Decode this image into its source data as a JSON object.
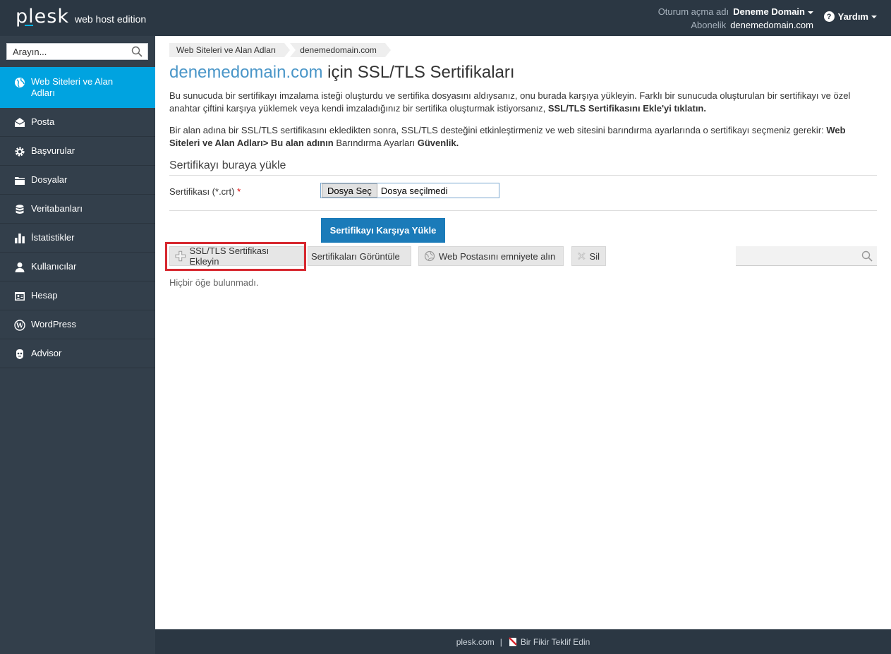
{
  "header": {
    "logo": "plesk",
    "edition": "web host edition",
    "login_label": "Oturum açma adı",
    "login_value": "Deneme Domain",
    "subscription_label": "Abonelik",
    "subscription_value": "denemedomain.com",
    "help_label": "Yardım"
  },
  "sidebar": {
    "search_placeholder": "Arayın...",
    "items": [
      {
        "label": "Web Siteleri ve Alan Adları",
        "icon": "globe-icon",
        "active": true
      },
      {
        "label": "Posta",
        "icon": "mail-icon"
      },
      {
        "label": "Başvurular",
        "icon": "gear-icon"
      },
      {
        "label": "Dosyalar",
        "icon": "folder-icon"
      },
      {
        "label": "Veritabanları",
        "icon": "database-icon"
      },
      {
        "label": "İstatistikler",
        "icon": "bar-chart-icon"
      },
      {
        "label": "Kullanıcılar",
        "icon": "user-icon"
      },
      {
        "label": "Hesap",
        "icon": "account-icon"
      },
      {
        "label": "WordPress",
        "icon": "wordpress-icon"
      },
      {
        "label": "Advisor",
        "icon": "advisor-icon"
      }
    ]
  },
  "breadcrumb": [
    "Web Siteleri ve Alan Adları",
    "denemedomain.com"
  ],
  "page": {
    "title_domain": "denemedomain.com",
    "title_rest": " için SSL/TLS Sertifikaları",
    "desc1_text": "Bu sunucuda bir sertifikayı imzalama isteği oluşturdu ve sertifika dosyasını aldıysanız, onu burada karşıya yükleyin. Farklı bir sunucuda oluşturulan bir sertifikayı ve özel anahtar çiftini karşıya yüklemek veya kendi imzaladığınız bir sertifika oluşturmak istiyorsanız, ",
    "desc1_bold": "SSL/TLS Sertifikasını Ekle'yi tıklatın.",
    "desc2_text": "Bir alan adına bir SSL/TLS sertifikasını ekledikten sonra, SSL/TLS desteğini etkinleştirmeniz ve web sitesini barındırma ayarlarında o sertifikayı seçmeniz gerekir: ",
    "desc2_bold1": "Web Siteleri ve Alan Adları> Bu alan adının",
    "desc2_mid": " Barındırma Ayarları ",
    "desc2_bold2": "Güvenlik.",
    "section_title": "Sertifikayı buraya yükle",
    "cert_label": "Sertifikası (*.crt)",
    "required_mark": "*",
    "file_button": "Dosya Seç",
    "file_status": "Dosya seçilmedi",
    "upload_button": "Sertifikayı Karşıya Yükle",
    "empty_message": "Hiçbir öğe bulunmadı."
  },
  "toolbar": {
    "add_label": "SSL/TLS Sertifikası Ekleyin",
    "view_label": "Sertifikaları Görüntüle",
    "secure_mail_label": "Web Postasını emniyete alın",
    "delete_label": "Sil",
    "search_placeholder": ""
  },
  "footer": {
    "link1": "plesk.com",
    "separator": "|",
    "link2": "Bir Fikir Teklif Edin"
  },
  "colors": {
    "topbar": "#2b3743",
    "sidebar": "#333f4b",
    "active": "#00a3e0",
    "primary_button": "#1b7bb9",
    "highlight": "#d7282f",
    "title_link": "#4a96c8"
  }
}
